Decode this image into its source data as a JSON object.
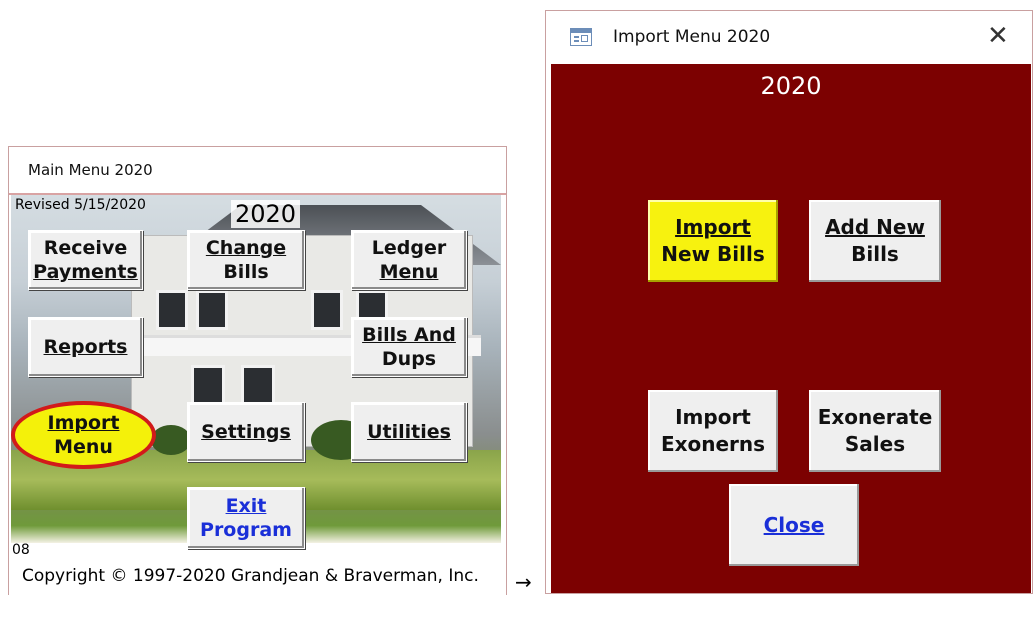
{
  "main_window": {
    "title": "Main Menu 2020",
    "revised": "Revised 5/15/2020",
    "year": "2020",
    "buttons": {
      "receive_payments": [
        "Receive",
        "Payments"
      ],
      "change_bills": [
        "Change",
        "Bills"
      ],
      "ledger_menu": [
        "Ledger",
        "Menu"
      ],
      "reports": "Reports",
      "bills_and_dups": [
        "Bills And",
        "Dups"
      ],
      "import_menu": [
        "Import",
        "Menu"
      ],
      "settings": "Settings",
      "utilities": "Utilities",
      "exit_program": [
        "Exit",
        "Program"
      ]
    },
    "code": "08",
    "copyright": "Copyright © 1997-2020 Grandjean & Braverman, Inc."
  },
  "arrow": "→",
  "import_window": {
    "title": "Import Menu 2020",
    "close_glyph": "✕",
    "year": "2020",
    "buttons": {
      "import_new_bills": [
        "Import",
        "New Bills"
      ],
      "add_new_bills": [
        "Add New",
        "Bills"
      ],
      "import_exonerns": [
        "Import",
        "Exonerns"
      ],
      "exonerate_sales": [
        "Exonerate",
        "Sales"
      ],
      "close": "Close"
    }
  },
  "colors": {
    "import_bg": "#7c0101",
    "highlight_yellow": "#f7f20f",
    "link_blue": "#1a2fd8",
    "oval_border": "#d21a1a"
  },
  "icons": {
    "form_icon": "form-icon",
    "close_icon": "close-icon"
  }
}
